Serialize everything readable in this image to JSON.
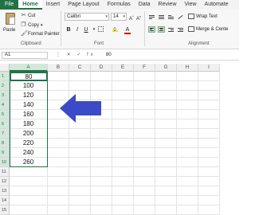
{
  "ribbon_tabs": [
    "File",
    "Home",
    "Insert",
    "Page Layout",
    "Formulas",
    "Data",
    "Review",
    "View",
    "Automate"
  ],
  "clipboard": {
    "paste_label": "Paste",
    "cut_label": "Cut",
    "copy_label": "Copy",
    "format_painter_label": "Format Painter",
    "group_label": "Clipboard"
  },
  "font": {
    "font_name": "Calibri",
    "font_size": "14",
    "bold_label": "B",
    "italic_label": "I",
    "underline_label": "U",
    "font_color_label": "A",
    "group_label": "Font"
  },
  "alignment": {
    "wrap_text_label": "Wrap Text",
    "merge_label": "Merge & Cente",
    "group_label": "Alignment"
  },
  "formula_bar": {
    "name_box": "A1",
    "fx_symbols": "⋮ ✕ ✓ fx",
    "value": "80"
  },
  "columns": [
    "A",
    "B",
    "C",
    "D",
    "E",
    "F",
    "G",
    "H",
    "I"
  ],
  "rows": [
    "1",
    "2",
    "3",
    "4",
    "5",
    "6",
    "7",
    "8",
    "9",
    "10",
    "11",
    "12",
    "13",
    "14",
    "15",
    "16"
  ],
  "column_a_values": [
    "80",
    "100",
    "120",
    "140",
    "160",
    "180",
    "200",
    "220",
    "240",
    "260"
  ],
  "colors": {
    "excel_green": "#217346",
    "arrow_blue": "#3b4bc8"
  }
}
